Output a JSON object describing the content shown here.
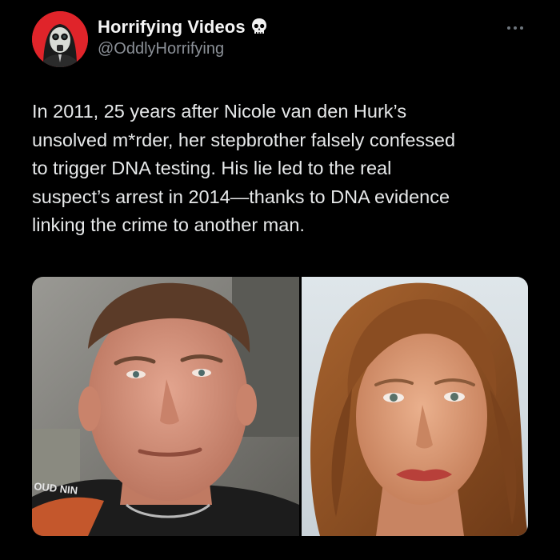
{
  "author": {
    "display_name": "Horrifying Videos",
    "handle": "@OddlyHorrifying",
    "verified_icon": "skull-icon",
    "avatar_icon": "gasmask-avatar-icon"
  },
  "post": {
    "text_lines": [
      "In 2011, 25 years after Nicole van den Hurk’s",
      "unsolved m*rder, her stepbrother falsely confessed",
      "to trigger DNA testing. His lie led to the real",
      "suspect’s arrest in 2014—thanks to DNA evidence",
      "linking the crime to another man."
    ],
    "more_icon": "ellipsis-icon"
  },
  "media": {
    "left_photo_caption": "OUD NIN",
    "left_photo_subject": "man-portrait",
    "right_photo_subject": "girl-portrait"
  },
  "colors": {
    "background": "#000000",
    "text": "#e7e9ea",
    "handle": "#8b9097",
    "avatar_bg": "#e0242a"
  }
}
